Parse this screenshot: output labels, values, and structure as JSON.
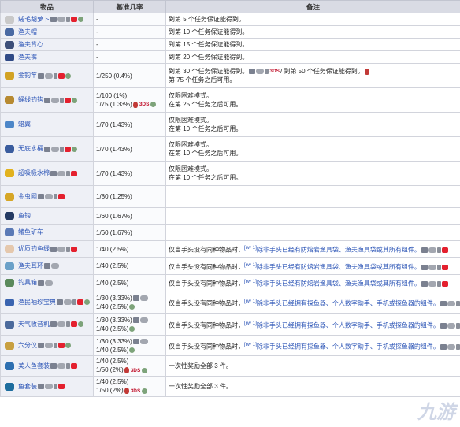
{
  "headers": [
    "物品",
    "基准几率",
    "备注"
  ],
  "rows": [
    {
      "name": "绒毛胡萝卜",
      "icon": "carrot-icon",
      "icon_color": "#c9c9c9",
      "rate": "-",
      "rate2": "",
      "note": "到第 5 个任务保证能得到。",
      "note2": ""
    },
    {
      "name": "渔夫帽",
      "icon": "hat-icon",
      "icon_color": "#4a6aa3",
      "rate": "-",
      "rate2": "",
      "note": "到第 10 个任务保证能得到。",
      "note2": ""
    },
    {
      "name": "渔夫背心",
      "icon": "vest-icon",
      "icon_color": "#3d4f79",
      "rate": "-",
      "rate2": "",
      "note": "到第 15 个任务保证能得到。",
      "note2": ""
    },
    {
      "name": "渔夫裤",
      "icon": "pants-icon",
      "icon_color": "#304a86",
      "rate": "-",
      "rate2": "",
      "note": "到第 20 个任务保证能得到。",
      "note2": ""
    },
    {
      "name": "金钓竿",
      "icon": "fishing-rod-icon",
      "icon_color": "#d2a223",
      "rate": "1/250 (0.4%)",
      "rate2": "",
      "note": "到第 30 个任务保证能得到。",
      "note_mid": "3DS",
      "note_tail": "/ 到第 50 个任务保证能得到。",
      "note2": "第 75 个任务之后可用。"
    },
    {
      "name": "蛹线钓钩",
      "icon": "hook-icon",
      "icon_color": "#b78a31",
      "rate": "1/100 (1%)",
      "rate2": "1/75 (1.33%)",
      "note": "仅限困难模式。",
      "note2": "在第 25 个任务之后可用。"
    },
    {
      "name": "蜡翼",
      "icon": "wings-icon",
      "icon_color": "#4c86c8",
      "rate": "1/70 (1.43%)",
      "rate2": "",
      "note": "仅限困难模式。",
      "note2": "在第 10 个任务之后可用。"
    },
    {
      "name": "无底水桶",
      "icon": "bucket-icon",
      "icon_color": "#3a5c9e",
      "rate": "1/70 (1.43%)",
      "rate2": "",
      "note": "仅限困难模式。",
      "note2": "在第 10 个任务之后可用。"
    },
    {
      "name": "超吸吸水棉",
      "icon": "sponge-icon",
      "icon_color": "#e2b21e",
      "rate": "1/70 (1.43%)",
      "rate2": "",
      "note": "仅限困难模式。",
      "note2": "在第 10 个任务之后可用。"
    },
    {
      "name": "金虫网",
      "icon": "bug-net-icon",
      "icon_color": "#d6a626",
      "rate": "1/80 (1.25%)",
      "rate2": "",
      "note": "",
      "note2": ""
    },
    {
      "name": "鱼钩",
      "icon": "fish-hook-icon",
      "icon_color": "#243a63",
      "rate": "1/60 (1.67%)",
      "rate2": "",
      "note": "",
      "note2": ""
    },
    {
      "name": "鳍鱼矿车",
      "icon": "minecart-icon",
      "icon_color": "#5b7ab6",
      "rate": "1/60 (1.67%)",
      "rate2": "",
      "note": "",
      "note2": ""
    },
    {
      "name": "优质钓鱼线",
      "icon": "fishing-line-icon",
      "icon_color": "#e5c8ad",
      "rate": "1/40 (2.5%)",
      "rate2": "",
      "note": "仅当手头没有同种物品时，",
      "note_link": "除非手头已经有防熔岩渔具袋、渔夫渔具袋或其所有组件。",
      "note2": ""
    },
    {
      "name": "渔夫耳环",
      "icon": "earring-icon",
      "icon_color": "#6aa0c8",
      "rate": "1/40 (2.5%)",
      "rate2": "",
      "note": "仅当手头没有同种物品时，",
      "note_link": "除非手头已经有防熔岩渔具袋、渔夫渔具袋或其所有组件。",
      "note2": ""
    },
    {
      "name": "钓具箱",
      "icon": "tackle-box-icon",
      "icon_color": "#5b8a5c",
      "rate": "1/40 (2.5%)",
      "rate2": "",
      "note": "仅当手头没有同种物品时，",
      "note_link": "除非手头已经有防熔岩渔具袋、渔夫渔具袋或其所有组件。",
      "note2": ""
    },
    {
      "name": "渔民袖珍宝典",
      "icon": "book-icon",
      "icon_color": "#3a64b0",
      "rate": "1/30 (3.33%)",
      "rate2": "1/40 (2.5%)",
      "note": "仅当手头没有同种物品时，",
      "note_link": "除非手头已经拥有探鱼器、个人数字助手、手机或探鱼器的组件。",
      "note2": ""
    },
    {
      "name": "天气收音机",
      "icon": "radio-icon",
      "icon_color": "#4b6a9c",
      "rate": "1/30 (3.33%)",
      "rate2": "1/40 (2.5%)",
      "note": "仅当手头没有同种物品时，",
      "note_link": "除非手头已经拥有探鱼器、个人数字助手、手机或探鱼器的组件。",
      "note2": ""
    },
    {
      "name": "六分仪",
      "icon": "sextant-icon",
      "icon_color": "#c8a040",
      "rate": "1/30 (3.33%)",
      "rate2": "1/40 (2.5%)",
      "note": "仅当手头没有同种物品时，",
      "note_link": "除非手头已经拥有探鱼器、个人数字助手、手机或探鱼器的组件。",
      "note2": ""
    },
    {
      "name": "美人鱼套装",
      "icon": "mermaid-icon",
      "icon_color": "#2d6fb0",
      "rate": "1/40 (2.5%)",
      "rate2": "1/50 (2%)",
      "note": "一次性奖励全部 3 件。",
      "note2": ""
    },
    {
      "name": "鱼套装",
      "icon": "fish-costume-icon",
      "icon_color": "#1d6d9e",
      "rate": "1/40 (2.5%)",
      "rate2": "1/50 (2%)",
      "note": "一次性奖励全部 3 件。",
      "note2": ""
    }
  ],
  "ref": "[rw 1]",
  "badge_3ds": "3DS",
  "watermark": "九游"
}
